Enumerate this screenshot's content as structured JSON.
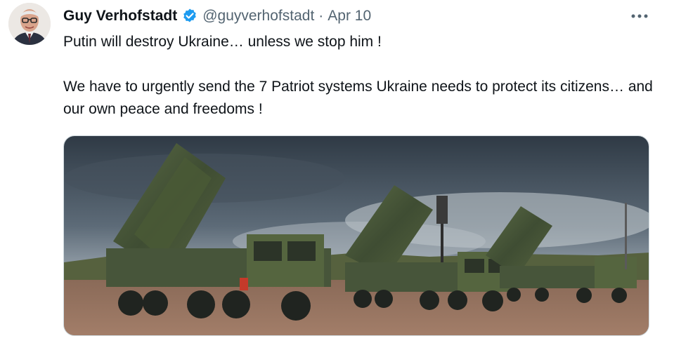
{
  "author": {
    "name": "Guy Verhofstadt",
    "handle": "@guyverhofstadt",
    "separator": "·",
    "date": "Apr 10",
    "verified_color": "#1d9bf0"
  },
  "tweet": {
    "line1": "Putin will destroy Ukraine… unless we stop him !",
    "line2": "We have to urgently send the 7 Patriot systems Ukraine needs to protect its citizens… and our own peace and freedoms !"
  },
  "icons": {
    "verified": "verified-badge-icon",
    "more": "more-options-icon"
  },
  "media": {
    "subject": "Patriot missile launcher trucks"
  }
}
